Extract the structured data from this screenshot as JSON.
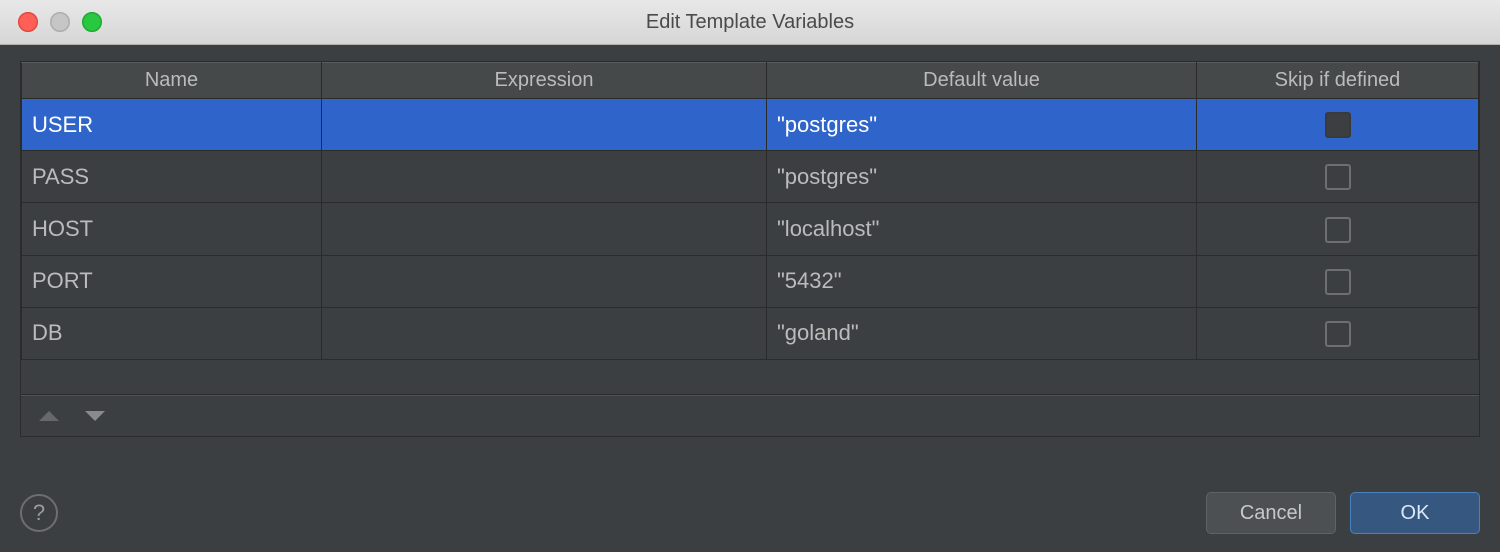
{
  "window": {
    "title": "Edit Template Variables"
  },
  "columns": {
    "name": "Name",
    "expression": "Expression",
    "default_value": "Default value",
    "skip": "Skip if defined"
  },
  "rows": [
    {
      "name": "USER",
      "expression": "",
      "default_value": "\"postgres\"",
      "skip": false,
      "selected": true
    },
    {
      "name": "PASS",
      "expression": "",
      "default_value": "\"postgres\"",
      "skip": false,
      "selected": false
    },
    {
      "name": "HOST",
      "expression": "",
      "default_value": "\"localhost\"",
      "skip": false,
      "selected": false
    },
    {
      "name": "PORT",
      "expression": "",
      "default_value": "\"5432\"",
      "skip": false,
      "selected": false
    },
    {
      "name": "DB",
      "expression": "",
      "default_value": "\"goland\"",
      "skip": false,
      "selected": false
    }
  ],
  "reorder": {
    "up_enabled": false,
    "down_enabled": true
  },
  "buttons": {
    "help_label": "?",
    "cancel": "Cancel",
    "ok": "OK"
  }
}
